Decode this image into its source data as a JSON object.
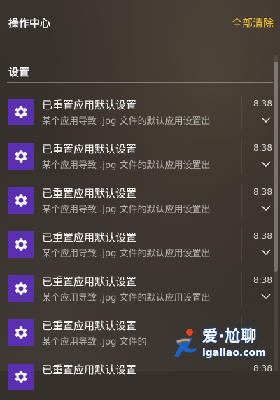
{
  "header": {
    "title": "操作中心",
    "clear_all": "全部清除"
  },
  "section": {
    "title": "设置"
  },
  "notifications": [
    {
      "title": "已重置应用默认设置",
      "desc": "某个应用导致 .jpg 文件的默认应用设置出",
      "time": "8:38",
      "icon": "gear-icon"
    },
    {
      "title": "已重置应用默认设置",
      "desc": "某个应用导致 .jpg 文件的默认应用设置出",
      "time": "8:38",
      "icon": "gear-icon"
    },
    {
      "title": "已重置应用默认设置",
      "desc": "某个应用导致 .jpg 文件的默认应用设置出",
      "time": "8:38",
      "icon": "gear-icon"
    },
    {
      "title": "已重置应用默认设置",
      "desc": "某个应用导致 .jpg 文件的默认应用设置出",
      "time": "8:38",
      "icon": "gear-icon"
    },
    {
      "title": "已重置应用默认设置",
      "desc": "某个应用导致 .jpg 文件的默认应用设置出",
      "time": "8:38",
      "icon": "gear-icon"
    },
    {
      "title": "已重置应用默认设置",
      "desc": "某个应用导致 .jpg 文件的",
      "time": "",
      "icon": "gear-icon"
    },
    {
      "title": "已重置应用默认设置",
      "desc": "",
      "time": "8:38",
      "icon": "gear-icon"
    }
  ],
  "watermark": {
    "line1": "爱·尬聊",
    "line2": "igaliao.com"
  },
  "colors": {
    "accent": "#f2c12e",
    "icon_bg": "#5b30b0"
  }
}
